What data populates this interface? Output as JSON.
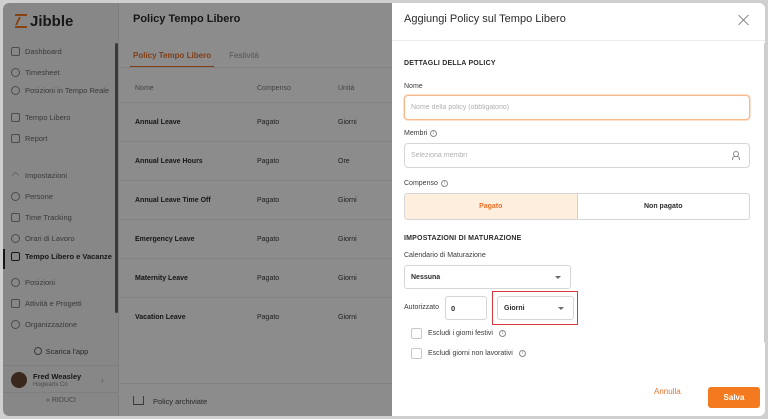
{
  "sidebar": {
    "logo": "Jibble",
    "items": [
      {
        "label": "Dashboard",
        "icon": "dashboard-icon"
      },
      {
        "label": "Timesheet",
        "icon": "clock-icon"
      },
      {
        "label": "Posizioni in Tempo Reale",
        "icon": "location-icon"
      },
      {
        "label": "Tempo Libero",
        "icon": "suitcase-icon"
      },
      {
        "label": "Report",
        "icon": "report-icon"
      },
      {
        "label": "Impostazioni",
        "icon": "chevron-up-icon"
      },
      {
        "label": "Persone",
        "icon": "people-icon"
      },
      {
        "label": "Time Tracking",
        "icon": "time-tracking-icon"
      },
      {
        "label": "Orari di Lavoro",
        "icon": "schedule-icon"
      },
      {
        "label": "Tempo Libero e Vacanze",
        "icon": "suitcase-icon"
      },
      {
        "label": "Posizioni",
        "icon": "location-icon"
      },
      {
        "label": "Attività e Progetti",
        "icon": "tag-icon"
      },
      {
        "label": "Organizzazione",
        "icon": "gear-icon"
      }
    ],
    "download_app": "Scarica l'app",
    "user": {
      "name": "Fred Weasley",
      "org": "Hogwarts Co"
    },
    "collapse": "« RIDUCI"
  },
  "main": {
    "title": "Policy Tempo Libero",
    "tabs": [
      "Policy Tempo Libero",
      "Festività"
    ],
    "columns": [
      "Nome",
      "Compenso",
      "Unità"
    ],
    "rows": [
      {
        "name": "Annual Leave",
        "comp": "Pagato",
        "unit": "Giorni"
      },
      {
        "name": "Annual Leave Hours",
        "comp": "Pagato",
        "unit": "Ore"
      },
      {
        "name": "Annual Leave Time Off",
        "comp": "Pagato",
        "unit": "Giorni"
      },
      {
        "name": "Emergency Leave",
        "comp": "Pagato",
        "unit": "Giorni"
      },
      {
        "name": "Maternity Leave",
        "comp": "Pagato",
        "unit": "Giorni"
      },
      {
        "name": "Vacation Leave",
        "comp": "Pagato",
        "unit": "Giorni"
      }
    ],
    "archived": "Policy archiviate"
  },
  "panel": {
    "title": "Aggiungi Policy sul Tempo Libero",
    "section_details": "DETTAGLI DELLA POLICY",
    "name_label": "Nome",
    "name_placeholder": "Nome della policy (obbligatorio)",
    "members_label": "Membri",
    "members_placeholder": "Seleziona membri",
    "comp_label": "Compenso",
    "comp_options": [
      "Pagato",
      "Non pagato"
    ],
    "section_accrual": "IMPOSTAZIONI DI MATURAZIONE",
    "calendar_label": "Calendario di Maturazione",
    "calendar_value": "Nessuna",
    "authorized_label": "Autorizzato",
    "authorized_value": "0",
    "unit_value": "Giorni",
    "exclude_holidays": "Escludi i giorni festivi",
    "exclude_nonworking": "Escludi giorni non lavorativi",
    "cancel": "Annulla",
    "save": "Salva"
  },
  "colors": {
    "accent": "#f47a1f",
    "highlight": "#d9363e"
  }
}
